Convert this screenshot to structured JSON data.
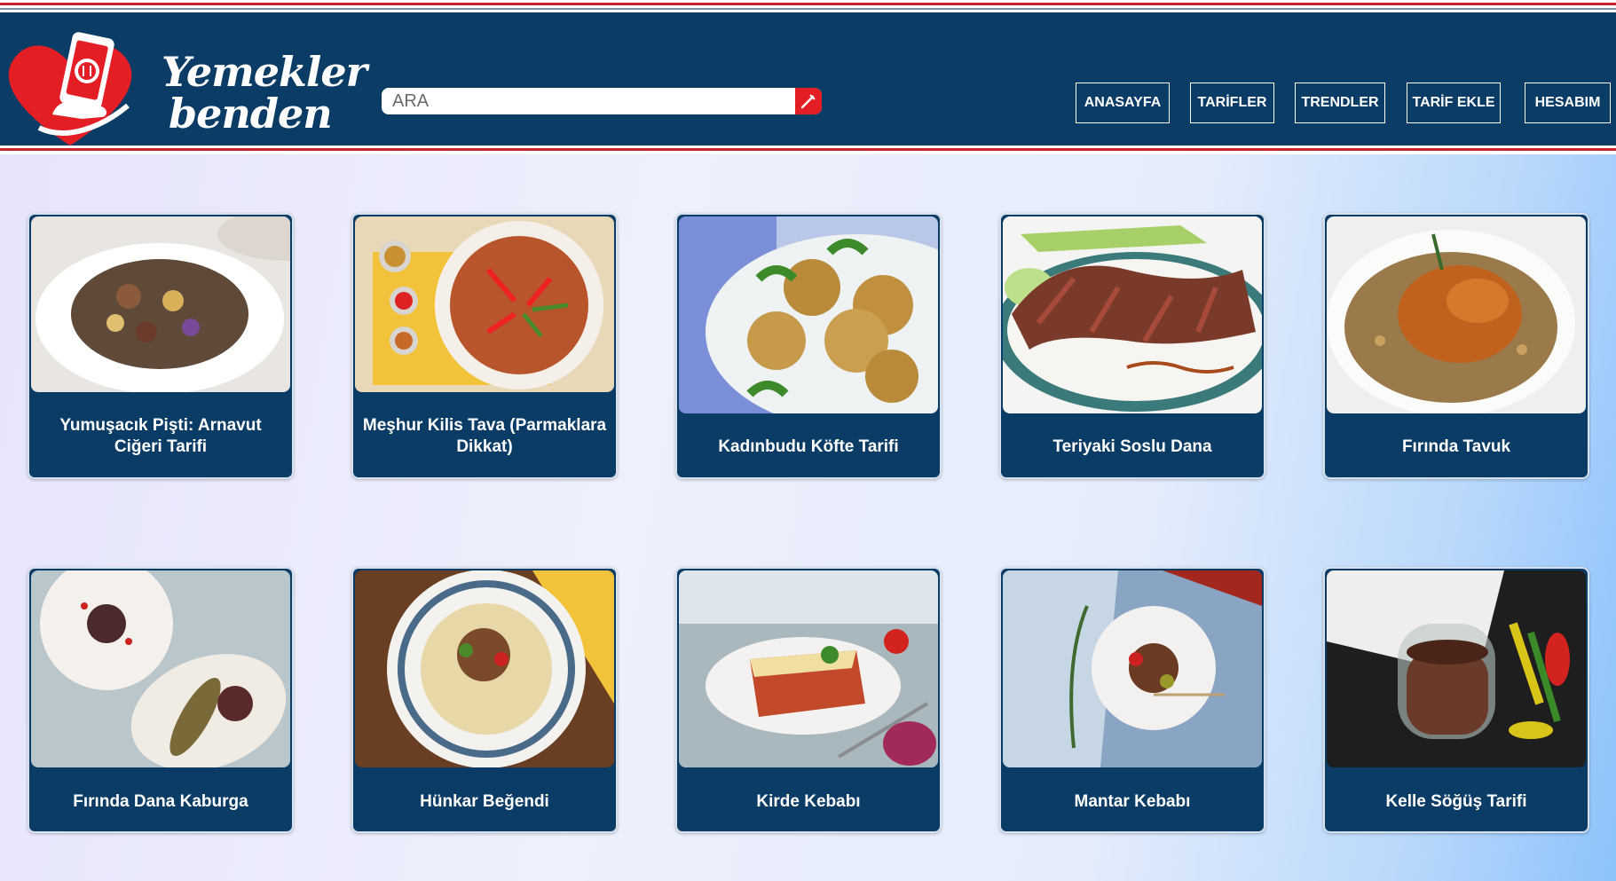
{
  "header": {
    "brand_line1": "Yemekler",
    "brand_line2": "benden",
    "search_placeholder": "ARA",
    "nav": [
      "ANASAYFA",
      "TARİFLER",
      "TRENDLER",
      "TARİF EKLE",
      "HESABIM"
    ]
  },
  "recipes": [
    "Yumuşacık Pişti: Arnavut Ciğeri Tarifi",
    "Meşhur Kilis Tava (Parmaklara Dikkat)",
    "Kadınbudu Köfte Tarifi",
    "Teriyaki Soslu Dana",
    "Fırında Tavuk",
    "Fırında Dana Kaburga",
    "Hünkar Beğendi",
    "Kirde Kebabı",
    "Mantar Kebabı",
    "Kelle Söğüş Tarifi"
  ],
  "colors": {
    "navy": "#0b3c66",
    "accent_red": "#e31e25"
  }
}
